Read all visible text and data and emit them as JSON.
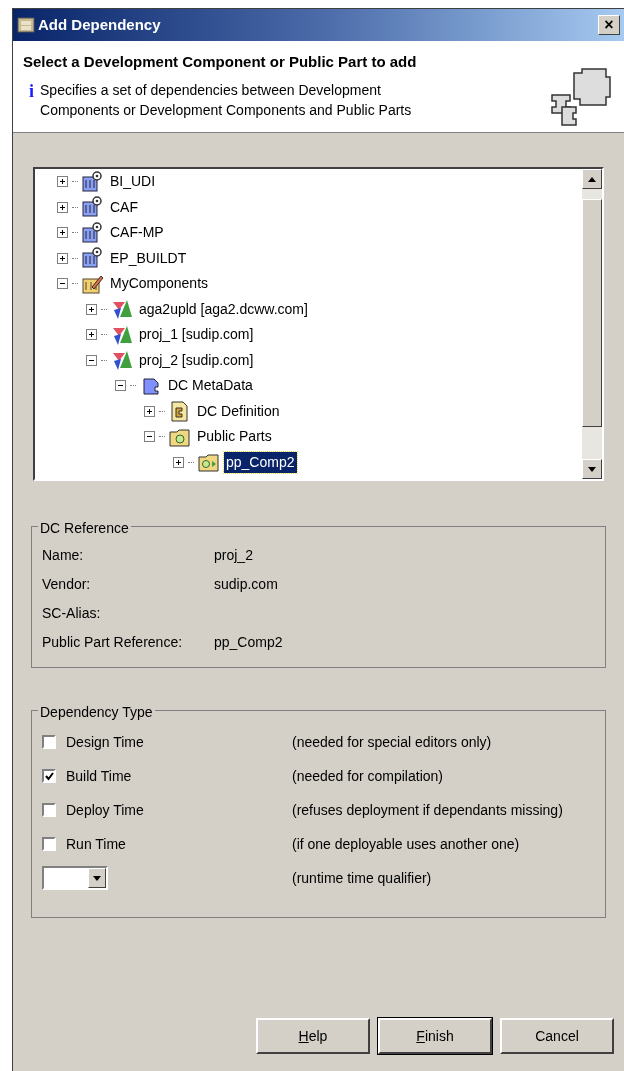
{
  "window": {
    "title": "Add Dependency",
    "close": "×"
  },
  "header": {
    "title": "Select a Development Component or Public Part to add",
    "info_icon": "i",
    "description": "Specifies a set of dependencies between Development Components or Development Components and Public Parts"
  },
  "tree": [
    {
      "label": "BI_UDI",
      "kind": "dc-group",
      "expanded": false,
      "selected": false
    },
    {
      "label": "CAF",
      "kind": "dc-group",
      "expanded": false,
      "selected": false
    },
    {
      "label": "CAF-MP",
      "kind": "dc-group",
      "expanded": false,
      "selected": false
    },
    {
      "label": "EP_BUILDT",
      "kind": "dc-group",
      "expanded": false,
      "selected": false
    },
    {
      "label": "MyComponents",
      "kind": "local",
      "expanded": true,
      "selected": false,
      "children": [
        {
          "label": "aga2upld [aga2.dcww.com]",
          "kind": "project",
          "expanded": false,
          "selected": false
        },
        {
          "label": "proj_1 [sudip.com]",
          "kind": "project",
          "expanded": false,
          "selected": false
        },
        {
          "label": "proj_2 [sudip.com]",
          "kind": "project",
          "expanded": true,
          "selected": false,
          "children": [
            {
              "label": "DC MetaData",
              "kind": "metadata",
              "expanded": true,
              "selected": false,
              "children": [
                {
                  "label": "DC Definition",
                  "kind": "definition",
                  "expanded": false,
                  "selected": false
                },
                {
                  "label": "Public Parts",
                  "kind": "folder",
                  "expanded": true,
                  "selected": false,
                  "children": [
                    {
                      "label": "pp_Comp2",
                      "kind": "public-part",
                      "expanded": false,
                      "selected": true
                    }
                  ]
                }
              ]
            }
          ]
        }
      ]
    }
  ],
  "dc_reference": {
    "title": "DC Reference",
    "fields": [
      {
        "label": "Name:",
        "value": "proj_2"
      },
      {
        "label": "Vendor:",
        "value": "sudip.com"
      },
      {
        "label": "SC-Alias:"
      },
      {
        "label": "Public Part Reference:",
        "value": "pp_Comp2"
      }
    ]
  },
  "dependency_type": {
    "title": "Dependency Type",
    "options": [
      {
        "label": "Design Time",
        "checked": false,
        "note": "(needed for special editors only)"
      },
      {
        "label": "Build Time",
        "checked": true,
        "note": "(needed for compilation)"
      },
      {
        "label": "Deploy Time",
        "checked": false,
        "note": "(refuses deployment if dependants missing)"
      },
      {
        "label": "Run Time",
        "checked": false,
        "note": "(if one deployable uses another one)"
      }
    ],
    "qualifier_note": "(runtime time qualifier)"
  },
  "buttons": [
    {
      "label": "Help",
      "mnemonic": true,
      "default": false
    },
    {
      "label": "Finish",
      "mnemonic": true,
      "default": true
    },
    {
      "label": "Cancel",
      "mnemonic": false,
      "default": false
    }
  ]
}
